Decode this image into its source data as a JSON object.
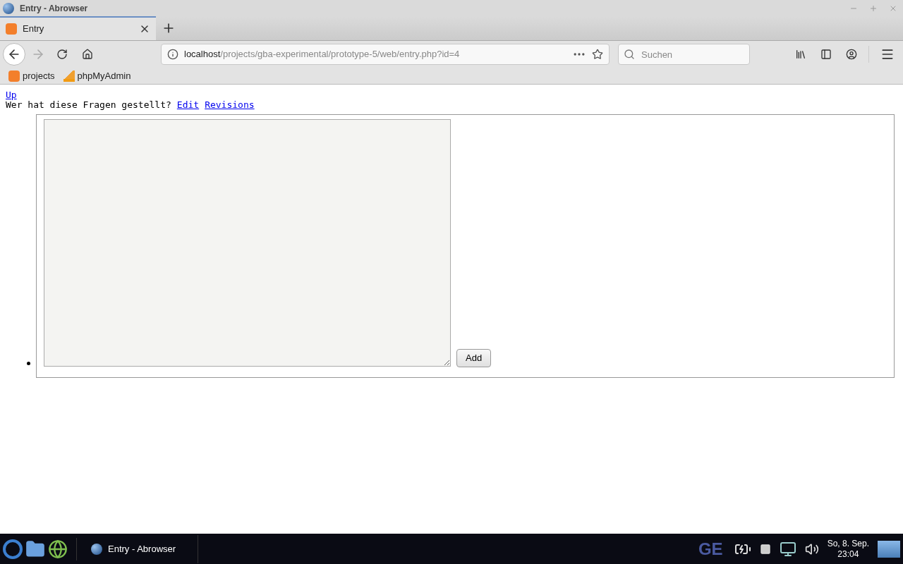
{
  "window": {
    "title": "Entry - Abrowser"
  },
  "tabs": [
    {
      "label": "Entry",
      "selected": true
    }
  ],
  "address": {
    "host": "localhost",
    "path": "/projects/gba-experimental/prototype-5/web/entry.php?id=4"
  },
  "search": {
    "placeholder": "Suchen"
  },
  "bookmarks": [
    {
      "label": "projects",
      "kind": "xampp"
    },
    {
      "label": "phpMyAdmin",
      "kind": "pma"
    }
  ],
  "page": {
    "up_link": "Up",
    "question": "Wer hat diese Fragen gestellt?",
    "links": [
      "Edit",
      "Revisions"
    ],
    "add_button": "Add"
  },
  "taskbar": {
    "tasks": [
      {
        "label": "Entry - Abrowser"
      }
    ],
    "keyboard": "GE",
    "date": "So, 8. Sep.",
    "time": "23:04"
  }
}
